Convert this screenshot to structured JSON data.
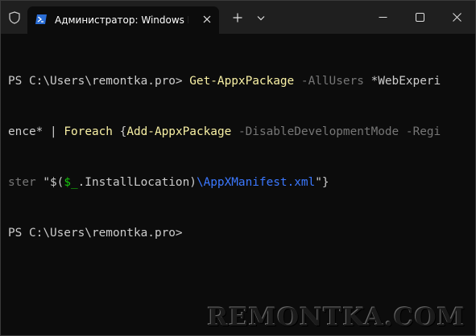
{
  "titlebar": {
    "tab_title": "Администратор: Windows PowerShell",
    "icons": {
      "shield": "shield-icon",
      "powershell": "powershell-icon",
      "close_tab": "close-icon",
      "new_tab": "plus-icon",
      "dropdown": "chevron-down-icon",
      "minimize": "minimize-icon",
      "maximize": "maximize-icon",
      "close_window": "close-icon"
    }
  },
  "terminal": {
    "line1": {
      "prompt": "PS C:\\Users\\remontka.pro> ",
      "cmd1": "Get-AppxPackage",
      "sp1": " ",
      "param1": "-AllUsers",
      "sp2": " ",
      "arg1": "*WebExperi"
    },
    "line2": {
      "arg1_cont": "ence*",
      "pipe": " | ",
      "cmd2": "Foreach",
      "brace": " {",
      "cmd3": "Add-AppxPackage",
      "sp1": " ",
      "param2": "-DisableDevelopmentMode",
      "sp2": " ",
      "param3": "-Regi"
    },
    "line3": {
      "param3_cont": "ster",
      "str_open": " \"$(",
      "var": "$_",
      "prop": ".InstallLocation)",
      "path": "\\AppXManifest.xml",
      "str_close": "\"}"
    },
    "line4": {
      "prompt": "PS C:\\Users\\remontka.pro> "
    }
  },
  "watermark": "REMONTKA.COM",
  "colors": {
    "background": "#0c0c0c",
    "titlebar": "#1f1f1f",
    "cmdlet": "#f9f1a5",
    "parameter": "#767676",
    "variable": "#16c60c",
    "path": "#3b78ff",
    "text": "#cccccc"
  }
}
